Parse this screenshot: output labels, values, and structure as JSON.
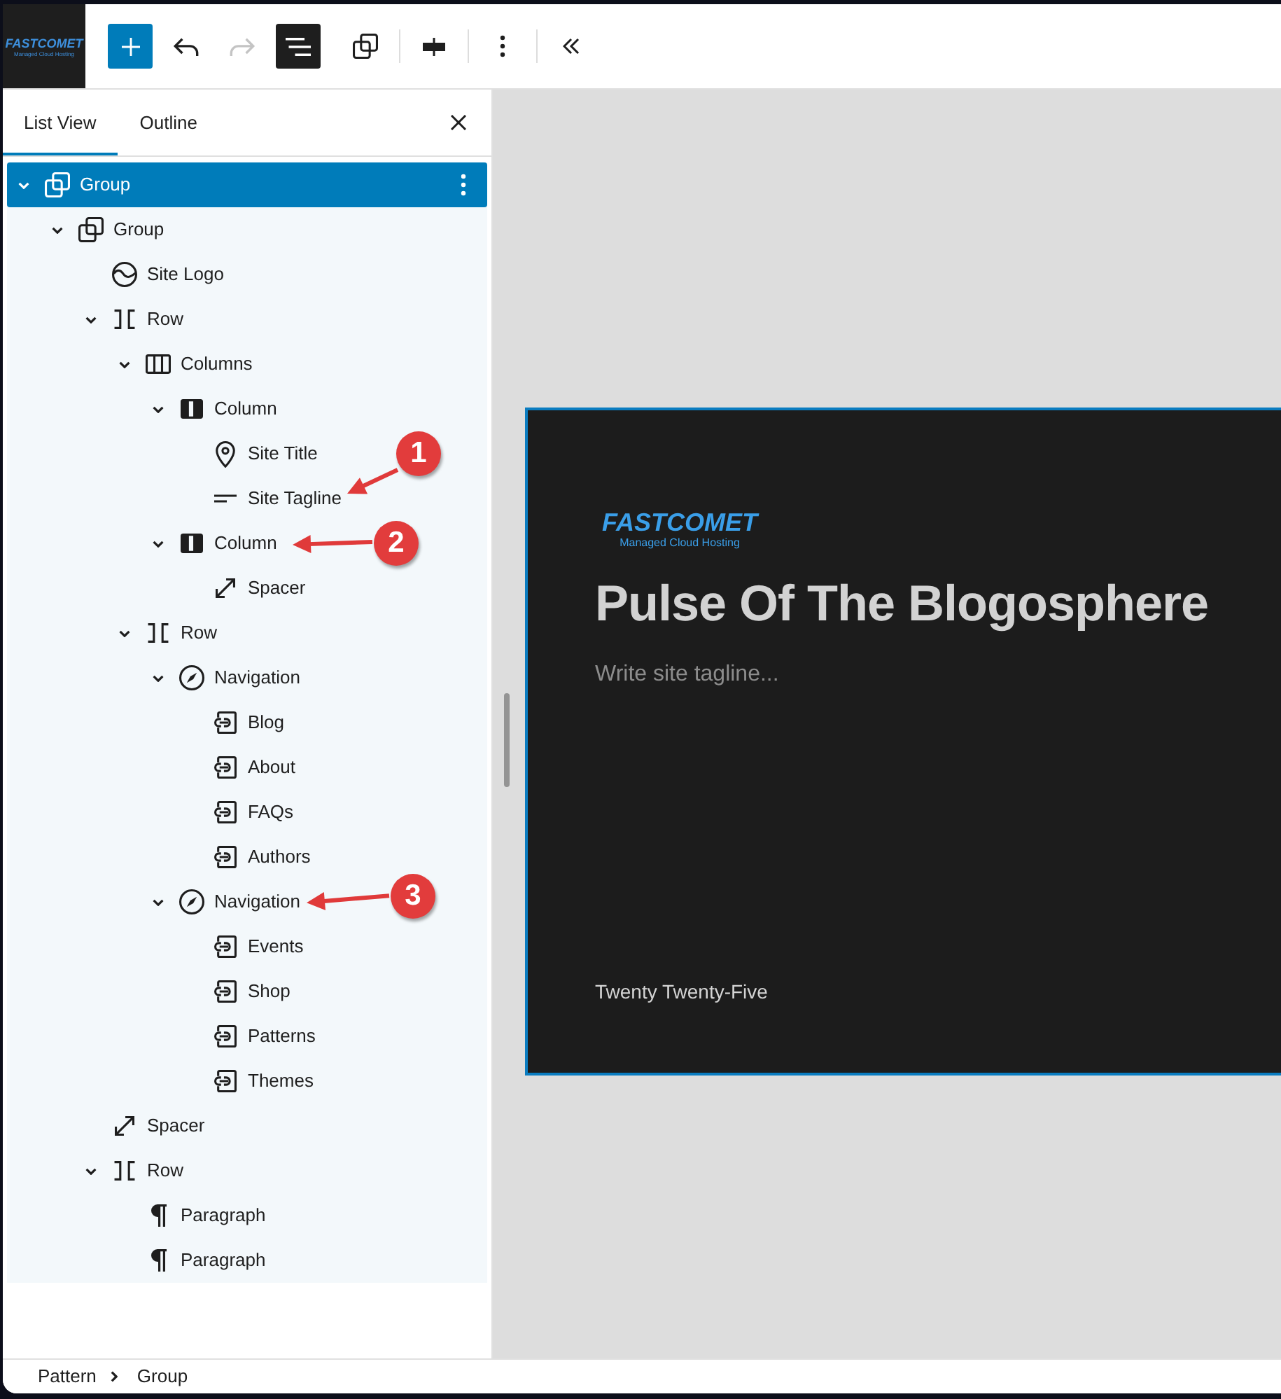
{
  "site_icon": {
    "wordmark": "FASTCOMET",
    "tagline": "Managed Cloud Hosting"
  },
  "toolbar": {
    "buttons": [
      {
        "kind": "add",
        "pressed": false,
        "disabled": false
      },
      {
        "kind": "undo",
        "pressed": false,
        "disabled": false
      },
      {
        "kind": "redo",
        "pressed": false,
        "disabled": true
      },
      {
        "kind": "list-view",
        "pressed": true,
        "disabled": false
      },
      {
        "kind": "group",
        "pressed": false,
        "disabled": false
      },
      {
        "kind": "separator"
      },
      {
        "kind": "align",
        "pressed": false,
        "disabled": false
      },
      {
        "kind": "separator"
      },
      {
        "kind": "options",
        "pressed": false,
        "disabled": false
      },
      {
        "kind": "separator"
      },
      {
        "kind": "collapse",
        "pressed": false,
        "disabled": false
      }
    ]
  },
  "sidebar": {
    "tabs": [
      {
        "label": "List View",
        "selected": true
      },
      {
        "label": "Outline",
        "selected": false
      }
    ],
    "tree": [
      {
        "label": "Group",
        "kind": "group",
        "selected": true,
        "expanded": true,
        "children": [
          {
            "label": "Group",
            "kind": "group",
            "selected": false,
            "expanded": true,
            "children": [
              {
                "label": "Site Logo",
                "kind": "site-logo",
                "selected": false
              },
              {
                "label": "Row",
                "kind": "row",
                "selected": false,
                "expanded": true,
                "children": [
                  {
                    "label": "Columns",
                    "kind": "columns",
                    "selected": false,
                    "expanded": true,
                    "children": [
                      {
                        "label": "Column",
                        "kind": "column",
                        "selected": false,
                        "expanded": true,
                        "children": [
                          {
                            "label": "Site Title",
                            "kind": "site-title",
                            "selected": false
                          },
                          {
                            "label": "Site Tagline",
                            "kind": "site-tagline",
                            "selected": false,
                            "callout": "1"
                          }
                        ]
                      },
                      {
                        "label": "Column",
                        "kind": "column",
                        "selected": false,
                        "expanded": true,
                        "callout": "2",
                        "children": [
                          {
                            "label": "Spacer",
                            "kind": "spacer",
                            "selected": false
                          }
                        ]
                      }
                    ]
                  },
                  {
                    "label": "Row",
                    "kind": "row",
                    "selected": false,
                    "expanded": true,
                    "children": [
                      {
                        "label": "Navigation",
                        "kind": "navigation",
                        "selected": false,
                        "expanded": true,
                        "children": [
                          {
                            "label": "Blog",
                            "kind": "page-link",
                            "selected": false
                          },
                          {
                            "label": "About",
                            "kind": "page-link",
                            "selected": false
                          },
                          {
                            "label": "FAQs",
                            "kind": "page-link",
                            "selected": false
                          },
                          {
                            "label": "Authors",
                            "kind": "page-link",
                            "selected": false
                          }
                        ]
                      },
                      {
                        "label": "Navigation",
                        "kind": "navigation",
                        "selected": false,
                        "expanded": true,
                        "callout": "3",
                        "children": [
                          {
                            "label": "Events",
                            "kind": "page-link",
                            "selected": false
                          },
                          {
                            "label": "Shop",
                            "kind": "page-link",
                            "selected": false
                          },
                          {
                            "label": "Patterns",
                            "kind": "page-link",
                            "selected": false
                          },
                          {
                            "label": "Themes",
                            "kind": "page-link",
                            "selected": false
                          }
                        ]
                      }
                    ]
                  }
                ]
              },
              {
                "label": "Spacer",
                "kind": "spacer",
                "selected": false
              },
              {
                "label": "Row",
                "kind": "row",
                "selected": false,
                "expanded": true,
                "children": [
                  {
                    "label": "Paragraph",
                    "kind": "paragraph",
                    "selected": false
                  },
                  {
                    "label": "Paragraph",
                    "kind": "paragraph",
                    "selected": false
                  }
                ]
              }
            ]
          }
        ]
      }
    ]
  },
  "canvas": {
    "preview": {
      "site_logo": {
        "wordmark": "FASTCOMET",
        "tagline": "Managed Cloud Hosting"
      },
      "site_title": "Pulse Of The Blogosphere",
      "site_tagline": {
        "placeholder": "Write site tagline..."
      },
      "footer_text": "Twenty Twenty-Five"
    }
  },
  "breadcrumbs": [
    {
      "label": "Pattern"
    },
    {
      "label": "Group"
    }
  ]
}
